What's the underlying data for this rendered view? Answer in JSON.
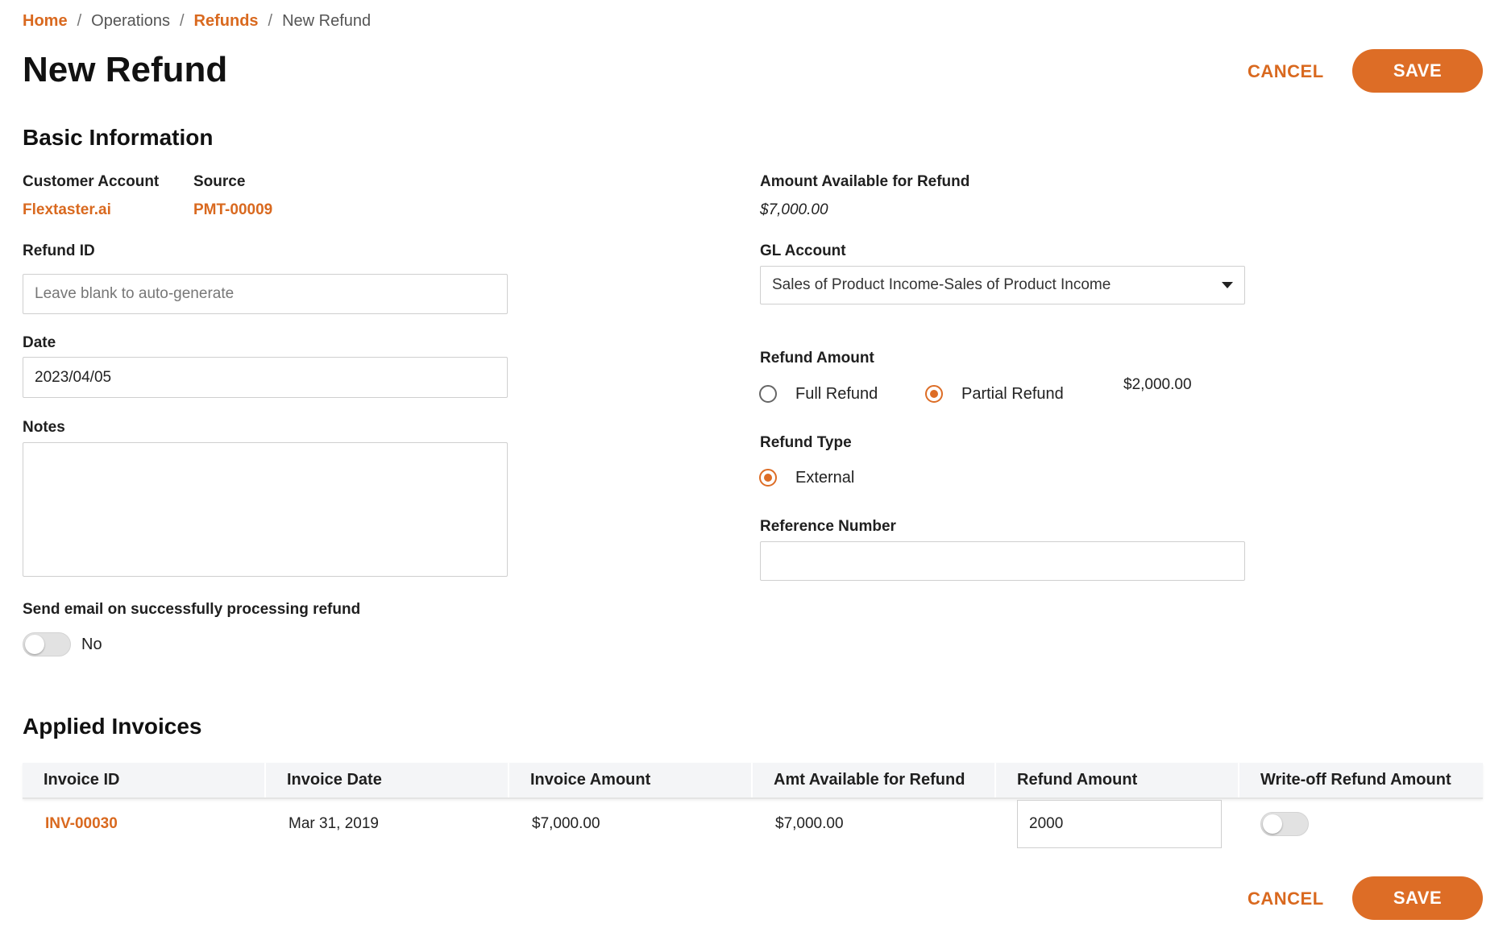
{
  "breadcrumb": {
    "home": "Home",
    "operations": "Operations",
    "refunds": "Refunds",
    "current": "New Refund",
    "separator": "/"
  },
  "header": {
    "title": "New Refund",
    "cancel_label": "CANCEL",
    "save_label": "SAVE"
  },
  "basic_info": {
    "title": "Basic Information",
    "customer_account_label": "Customer Account",
    "customer_account_value": "Flextaster.ai",
    "source_label": "Source",
    "source_value": "PMT-00009",
    "refund_id_label": "Refund ID",
    "refund_id_placeholder": "Leave blank to auto-generate",
    "date_label": "Date",
    "date_value": "2023/04/05",
    "notes_label": "Notes",
    "notes_value": "",
    "send_email_label": "Send email on successfully processing refund",
    "send_email_state": "No",
    "amount_available_label": "Amount Available for Refund",
    "amount_available_value": "$7,000.00",
    "gl_account_label": "GL Account",
    "gl_account_value": "Sales of Product Income-Sales of Product Income",
    "refund_amount_label": "Refund Amount",
    "full_refund_label": "Full Refund",
    "partial_refund_label": "Partial Refund",
    "partial_refund_amount": "$2,000.00",
    "refund_type_label": "Refund Type",
    "refund_type_external": "External",
    "reference_number_label": "Reference Number",
    "reference_number_value": ""
  },
  "applied_invoices": {
    "title": "Applied Invoices",
    "columns": [
      "Invoice ID",
      "Invoice Date",
      "Invoice Amount",
      "Amt Available for Refund",
      "Refund Amount",
      "Write-off Refund Amount"
    ],
    "rows": [
      {
        "invoice_id": "INV-00030",
        "invoice_date": "Mar 31, 2019",
        "invoice_amount": "$7,000.00",
        "amt_available": "$7,000.00",
        "refund_amount": "2000",
        "write_off": false
      }
    ]
  },
  "footer": {
    "cancel_label": "CANCEL",
    "save_label": "SAVE"
  },
  "colors": {
    "accent": "#dd6d26",
    "link": "#d9691f"
  }
}
